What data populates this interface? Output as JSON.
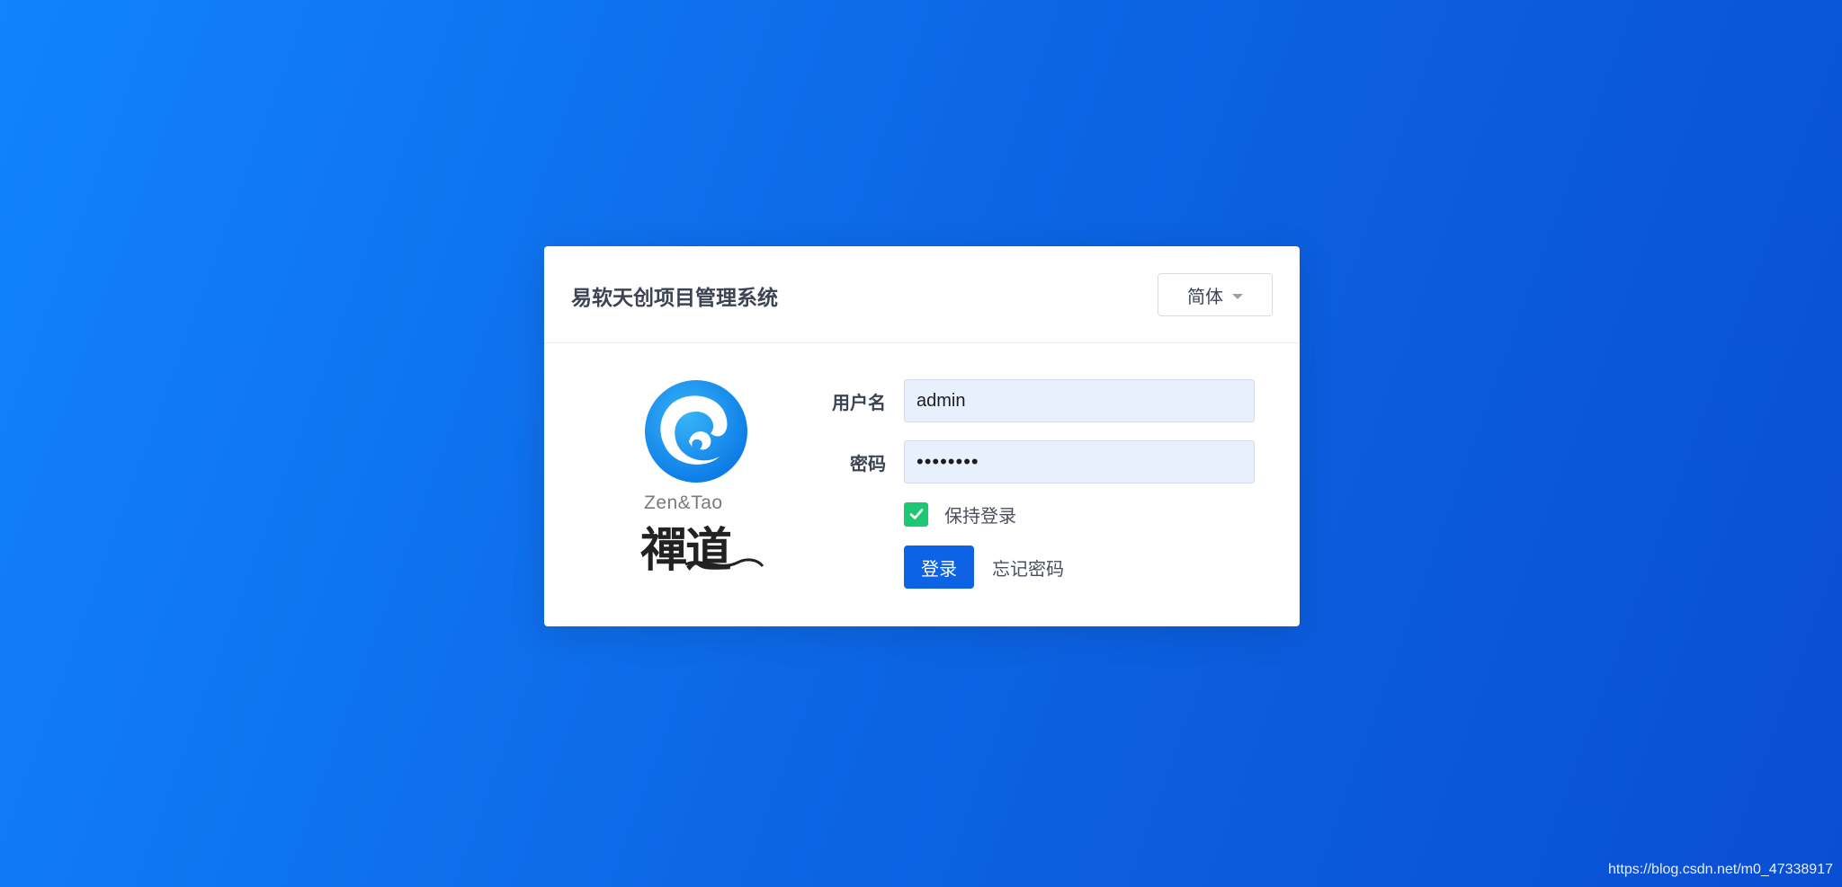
{
  "login": {
    "title": "易软天创项目管理系统",
    "language": {
      "selected": "简体"
    },
    "logo": {
      "latin_text": "Zen&Tao",
      "chinese_text": "禪道"
    },
    "username": {
      "label": "用户名",
      "value": "admin"
    },
    "password": {
      "label": "密码",
      "value": "••••••••"
    },
    "remember": {
      "label": "保持登录",
      "checked": true
    },
    "login_button": "登录",
    "forgot_link": "忘记密码"
  },
  "footer": {
    "url": "https://blog.csdn.net/m0_47338917"
  },
  "colors": {
    "background_start": "#1183fb",
    "background_end": "#0a4ed3",
    "primary_button": "#0e63e4",
    "checkbox": "#1ec773",
    "input_background": "#e8f0fe"
  },
  "icons": {
    "language_caret": "caret-down-icon",
    "checkbox_mark": "check-icon",
    "logo": "zentao-logo"
  }
}
